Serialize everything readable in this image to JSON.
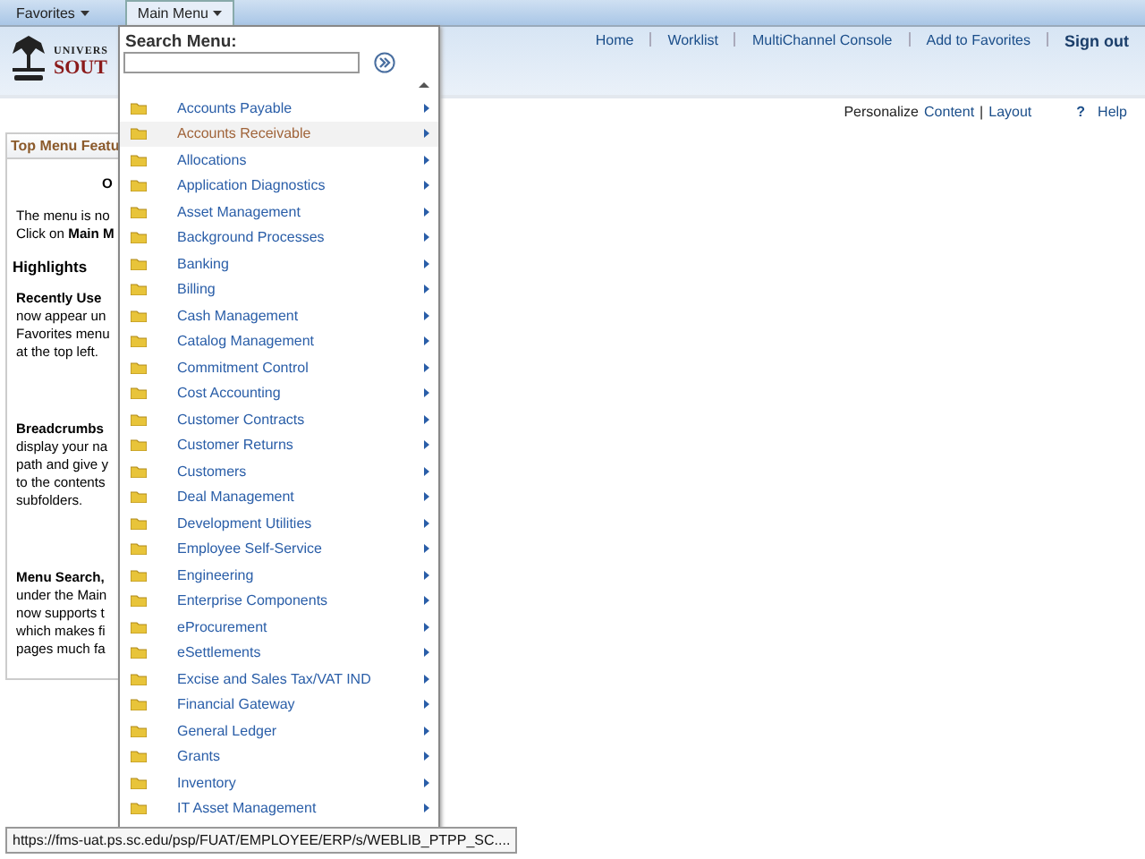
{
  "top_tabs": [
    {
      "label": "Favorites",
      "selected": false
    },
    {
      "label": "Main Menu",
      "selected": true
    }
  ],
  "logo": {
    "line_1": "UNIVERS",
    "line_2": "SOUT"
  },
  "nav_links": [
    {
      "label": "Home",
      "kind": "link"
    },
    {
      "label": "Worklist",
      "kind": "link"
    },
    {
      "label": "MultiChannel Console",
      "kind": "link"
    },
    {
      "label": "Add to Favorites",
      "kind": "link"
    },
    {
      "label": "Sign out",
      "kind": "strong"
    }
  ],
  "personalize": {
    "label": "Personalize",
    "content": "Content",
    "separator": "|",
    "layout": "Layout",
    "help": "Help",
    "help_mark": "?"
  },
  "panel": {
    "title": "Top Menu Featu",
    "lines": [
      {
        "kind": "center",
        "text": "O"
      },
      {
        "kind": "text",
        "text": "The menu is no"
      },
      {
        "kind": "text",
        "text": "Click on **Main M**"
      },
      {
        "kind": "heading",
        "text": "Highlights"
      },
      {
        "kind": "subhead",
        "text": "Recently Use"
      },
      {
        "kind": "text",
        "text": "now appear un"
      },
      {
        "kind": "text",
        "text": "Favorites menu"
      },
      {
        "kind": "text",
        "text": "at the top left."
      },
      {
        "kind": "gap"
      },
      {
        "kind": "subhead",
        "text": "Breadcrumbs"
      },
      {
        "kind": "text",
        "text": "display your na"
      },
      {
        "kind": "text",
        "text": "path and give y"
      },
      {
        "kind": "text",
        "text": "to the contents"
      },
      {
        "kind": "text",
        "text": "subfolders."
      },
      {
        "kind": "gap"
      },
      {
        "kind": "subhead",
        "text": "Menu Search,"
      },
      {
        "kind": "text",
        "text": "under the Main"
      },
      {
        "kind": "text",
        "text": "now supports t"
      },
      {
        "kind": "text",
        "text": "which makes fi"
      },
      {
        "kind": "text",
        "text": "pages much fa"
      }
    ]
  },
  "menu": {
    "search_label": "Search Menu:",
    "items": [
      {
        "label": "Accounts Payable",
        "selected": false
      },
      {
        "label": "Accounts Receivable",
        "selected": true
      },
      {
        "label": "Allocations",
        "selected": false
      },
      {
        "label": "Application Diagnostics",
        "selected": false
      },
      {
        "label": "Asset Management",
        "selected": false
      },
      {
        "label": "Background Processes",
        "selected": false
      },
      {
        "label": "Banking",
        "selected": false
      },
      {
        "label": "Billing",
        "selected": false
      },
      {
        "label": "Cash Management",
        "selected": false
      },
      {
        "label": "Catalog Management",
        "selected": false
      },
      {
        "label": "Commitment Control",
        "selected": false
      },
      {
        "label": "Cost Accounting",
        "selected": false
      },
      {
        "label": "Customer Contracts",
        "selected": false
      },
      {
        "label": "Customer Returns",
        "selected": false
      },
      {
        "label": "Customers",
        "selected": false
      },
      {
        "label": "Deal Management",
        "selected": false
      },
      {
        "label": "Development Utilities",
        "selected": false
      },
      {
        "label": "Employee Self-Service",
        "selected": false
      },
      {
        "label": "Engineering",
        "selected": false
      },
      {
        "label": "Enterprise Components",
        "selected": false
      },
      {
        "label": "eProcurement",
        "selected": false
      },
      {
        "label": "eSettlements",
        "selected": false
      },
      {
        "label": "Excise and Sales Tax/VAT IND",
        "selected": false
      },
      {
        "label": "Financial Gateway",
        "selected": false
      },
      {
        "label": "General Ledger",
        "selected": false
      },
      {
        "label": "Grants",
        "selected": false
      },
      {
        "label": "Inventory",
        "selected": false
      },
      {
        "label": "IT Asset Management",
        "selected": false
      }
    ]
  },
  "status_url": "https://fms-uat.ps.sc.edu/psp/FUAT/EMPLOYEE/ERP/s/WEBLIB_PTPP_SC...."
}
